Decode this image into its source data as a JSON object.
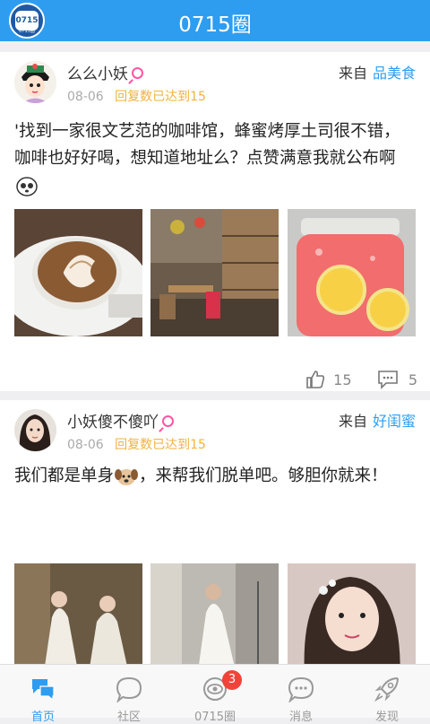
{
  "app": {
    "title": "0715圈",
    "logo_text": "0715",
    "logo_sub": "0715圈"
  },
  "posts": [
    {
      "username": "么么小妖",
      "date": "08-06",
      "reply_status": "回复数已达到15",
      "from_label": "来自",
      "category": "品美食",
      "content": "'找到一家很文艺范的咖啡馆，蜂蜜烤厚土司很不错，咖啡也好好喝，想知道地址么？点赞满意我就公布啊",
      "likes": "15",
      "comments": "5"
    },
    {
      "username": "小妖傻不傻吖",
      "date": "08-06",
      "reply_status": "回复数已达到15",
      "from_label": "来自",
      "category": "好闺蜜",
      "content_a": "我们都是单身",
      "content_b": "，来帮我们脱单吧。够胆你就来！"
    }
  ],
  "tabs": [
    {
      "label": "首页",
      "icon": "home-icon"
    },
    {
      "label": "社区",
      "icon": "chat-bubble-icon"
    },
    {
      "label": "0715圈",
      "icon": "eye-circle-icon",
      "badge": "3"
    },
    {
      "label": "消息",
      "icon": "message-icon"
    },
    {
      "label": "发现",
      "icon": "rocket-icon"
    }
  ],
  "colors": {
    "accent": "#2e9df0",
    "reply": "#f0b240",
    "gender": "#ff56a3",
    "badge": "#f0443b"
  }
}
